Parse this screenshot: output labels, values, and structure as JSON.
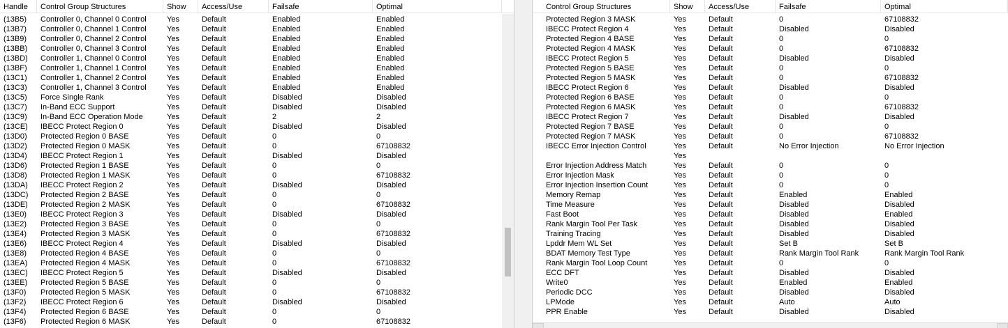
{
  "left": {
    "headers": [
      "Handle",
      "Control Group Structures",
      "Show",
      "Access/Use",
      "Failsafe",
      "Optimal"
    ],
    "rows": [
      [
        "(13B5)",
        "Controller 0, Channel 0 Control",
        "Yes",
        "Default",
        "Enabled",
        "Enabled"
      ],
      [
        "(13B7)",
        "Controller 0, Channel 1 Control",
        "Yes",
        "Default",
        "Enabled",
        "Enabled"
      ],
      [
        "(13B9)",
        "Controller 0, Channel 2 Control",
        "Yes",
        "Default",
        "Enabled",
        "Enabled"
      ],
      [
        "(13BB)",
        "Controller 0, Channel 3 Control",
        "Yes",
        "Default",
        "Enabled",
        "Enabled"
      ],
      [
        "(13BD)",
        "Controller 1, Channel 0 Control",
        "Yes",
        "Default",
        "Enabled",
        "Enabled"
      ],
      [
        "(13BF)",
        "Controller 1, Channel 1 Control",
        "Yes",
        "Default",
        "Enabled",
        "Enabled"
      ],
      [
        "(13C1)",
        "Controller 1, Channel 2 Control",
        "Yes",
        "Default",
        "Enabled",
        "Enabled"
      ],
      [
        "(13C3)",
        "Controller 1, Channel 3 Control",
        "Yes",
        "Default",
        "Enabled",
        "Enabled"
      ],
      [
        "(13C5)",
        "Force Single Rank",
        "Yes",
        "Default",
        "Disabled",
        "Disabled"
      ],
      [
        "(13C7)",
        "In-Band ECC Support",
        "Yes",
        "Default",
        "Disabled",
        "Disabled"
      ],
      [
        "(13C9)",
        "In-Band ECC Operation Mode",
        "Yes",
        "Default",
        "2",
        "2"
      ],
      [
        "(13CE)",
        "IBECC Protect Region 0",
        "Yes",
        "Default",
        "Disabled",
        "Disabled"
      ],
      [
        "(13D0)",
        "Protected Region 0 BASE",
        "Yes",
        "Default",
        "0",
        "0"
      ],
      [
        "(13D2)",
        "Protected Region 0 MASK",
        "Yes",
        "Default",
        "0",
        "67108832"
      ],
      [
        "(13D4)",
        "IBECC Protect Region 1",
        "Yes",
        "Default",
        "Disabled",
        "Disabled"
      ],
      [
        "(13D6)",
        "Protected Region 1 BASE",
        "Yes",
        "Default",
        "0",
        "0"
      ],
      [
        "(13D8)",
        "Protected Region 1 MASK",
        "Yes",
        "Default",
        "0",
        "67108832"
      ],
      [
        "(13DA)",
        "IBECC Protect Region 2",
        "Yes",
        "Default",
        "Disabled",
        "Disabled"
      ],
      [
        "(13DC)",
        "Protected Region 2 BASE",
        "Yes",
        "Default",
        "0",
        "0"
      ],
      [
        "(13DE)",
        "Protected Region 2 MASK",
        "Yes",
        "Default",
        "0",
        "67108832"
      ],
      [
        "(13E0)",
        "IBECC Protect Region 3",
        "Yes",
        "Default",
        "Disabled",
        "Disabled"
      ],
      [
        "(13E2)",
        "Protected Region 3 BASE",
        "Yes",
        "Default",
        "0",
        "0"
      ],
      [
        "(13E4)",
        "Protected Region 3 MASK",
        "Yes",
        "Default",
        "0",
        "67108832"
      ],
      [
        "(13E6)",
        "IBECC Protect Region 4",
        "Yes",
        "Default",
        "Disabled",
        "Disabled"
      ],
      [
        "(13E8)",
        "Protected Region 4 BASE",
        "Yes",
        "Default",
        "0",
        "0"
      ],
      [
        "(13EA)",
        "Protected Region 4 MASK",
        "Yes",
        "Default",
        "0",
        "67108832"
      ],
      [
        "(13EC)",
        "IBECC Protect Region 5",
        "Yes",
        "Default",
        "Disabled",
        "Disabled"
      ],
      [
        "(13EE)",
        "Protected Region 5 BASE",
        "Yes",
        "Default",
        "0",
        "0"
      ],
      [
        "(13F0)",
        "Protected Region 5 MASK",
        "Yes",
        "Default",
        "0",
        "67108832"
      ],
      [
        "(13F2)",
        "IBECC Protect Region 6",
        "Yes",
        "Default",
        "Disabled",
        "Disabled"
      ],
      [
        "(13F4)",
        "Protected Region 6 BASE",
        "Yes",
        "Default",
        "0",
        "0"
      ],
      [
        "(13F6)",
        "Protected Region 6 MASK",
        "Yes",
        "Default",
        "0",
        "67108832"
      ]
    ]
  },
  "right": {
    "headers": [
      "Control Group Structures",
      "Show",
      "Access/Use",
      "Failsafe",
      "Optimal"
    ],
    "rows": [
      [
        "Protected Region 3 MASK",
        "Yes",
        "Default",
        "0",
        "67108832"
      ],
      [
        "IBECC Protect Region 4",
        "Yes",
        "Default",
        "Disabled",
        "Disabled"
      ],
      [
        "Protected Region 4 BASE",
        "Yes",
        "Default",
        "0",
        "0"
      ],
      [
        "Protected Region 4 MASK",
        "Yes",
        "Default",
        "0",
        "67108832"
      ],
      [
        "IBECC Protect Region 5",
        "Yes",
        "Default",
        "Disabled",
        "Disabled"
      ],
      [
        "Protected Region 5 BASE",
        "Yes",
        "Default",
        "0",
        "0"
      ],
      [
        "Protected Region 5 MASK",
        "Yes",
        "Default",
        "0",
        "67108832"
      ],
      [
        "IBECC Protect Region 6",
        "Yes",
        "Default",
        "Disabled",
        "Disabled"
      ],
      [
        "Protected Region 6 BASE",
        "Yes",
        "Default",
        "0",
        "0"
      ],
      [
        "Protected Region 6 MASK",
        "Yes",
        "Default",
        "0",
        "67108832"
      ],
      [
        "IBECC Protect Region 7",
        "Yes",
        "Default",
        "Disabled",
        "Disabled"
      ],
      [
        "Protected Region 7 BASE",
        "Yes",
        "Default",
        "0",
        "0"
      ],
      [
        "Protected Region 7 MASK",
        "Yes",
        "Default",
        "0",
        "67108832"
      ],
      [
        "IBECC Error Injection Control",
        "Yes",
        "Default",
        "No Error Injection",
        "No Error Injection"
      ],
      [
        "",
        "Yes",
        "",
        "",
        ""
      ],
      [
        "Error Injection Address Match",
        "Yes",
        "Default",
        "0",
        "0"
      ],
      [
        "Error Injection Mask",
        "Yes",
        "Default",
        "0",
        "0"
      ],
      [
        "Error Injection Insertion Count",
        "Yes",
        "Default",
        "0",
        "0"
      ],
      [
        "Memory Remap",
        "Yes",
        "Default",
        "Enabled",
        "Enabled"
      ],
      [
        "Time Measure",
        "Yes",
        "Default",
        "Disabled",
        "Disabled"
      ],
      [
        "Fast Boot",
        "Yes",
        "Default",
        "Disabled",
        "Enabled"
      ],
      [
        "Rank Margin Tool Per Task",
        "Yes",
        "Default",
        "Disabled",
        "Disabled"
      ],
      [
        "Training Tracing",
        "Yes",
        "Default",
        "Disabled",
        "Disabled"
      ],
      [
        "Lpddr Mem WL Set",
        "Yes",
        "Default",
        "Set B",
        "Set B"
      ],
      [
        "BDAT Memory Test Type",
        "Yes",
        "Default",
        "Rank Margin Tool Rank",
        "Rank Margin Tool Rank"
      ],
      [
        "Rank Margin Tool Loop Count",
        "Yes",
        "Default",
        "0",
        "0"
      ],
      [
        "ECC DFT",
        "Yes",
        "Default",
        "Disabled",
        "Disabled"
      ],
      [
        "Write0",
        "Yes",
        "Default",
        "Enabled",
        "Enabled"
      ],
      [
        "Periodic DCC",
        "Yes",
        "Default",
        "Disabled",
        "Disabled"
      ],
      [
        "LPMode",
        "Yes",
        "Default",
        "Auto",
        "Auto"
      ],
      [
        "PPR Enable",
        "Yes",
        "Default",
        "Disabled",
        "Disabled"
      ]
    ]
  }
}
